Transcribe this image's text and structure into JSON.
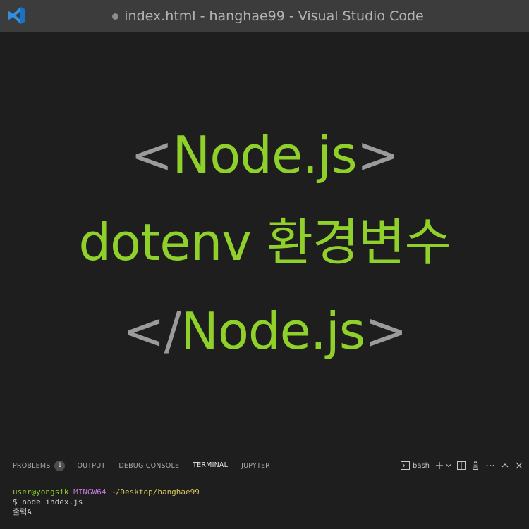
{
  "window": {
    "title": "index.html - hanghae99 - Visual Studio Code",
    "unsaved_indicator": true,
    "app_icon": "vscode-logo"
  },
  "hero": {
    "line1": {
      "open": "<",
      "text": "Node.js",
      "close": ">"
    },
    "line2": {
      "text": "dotenv 환경변수"
    },
    "line3": {
      "open": "</",
      "text": "Node.js",
      "close": ">"
    }
  },
  "panel": {
    "tabs": [
      {
        "label": "PROBLEMS",
        "badge": "1"
      },
      {
        "label": "OUTPUT"
      },
      {
        "label": "DEBUG CONSOLE"
      },
      {
        "label": "TERMINAL",
        "active": true
      },
      {
        "label": "JUPYTER"
      }
    ],
    "actions": {
      "shell_label": "bash",
      "icons": [
        "terminal-icon",
        "plus-icon",
        "chevron-down-icon",
        "split-icon",
        "trash-icon",
        "more-icon",
        "chevron-up-icon",
        "close-icon"
      ]
    }
  },
  "terminal": {
    "prompt_user": "user@yongsik",
    "prompt_host": "MINGW64",
    "prompt_path": "~/Desktop/hanghae99",
    "command_line": "$ node index.js",
    "output_line": "출력A"
  },
  "colors": {
    "accent_green": "#8fd12a",
    "bracket_gray": "#9b9b9b",
    "background": "#1e1e1e",
    "titlebar": "#3c3c3c"
  }
}
